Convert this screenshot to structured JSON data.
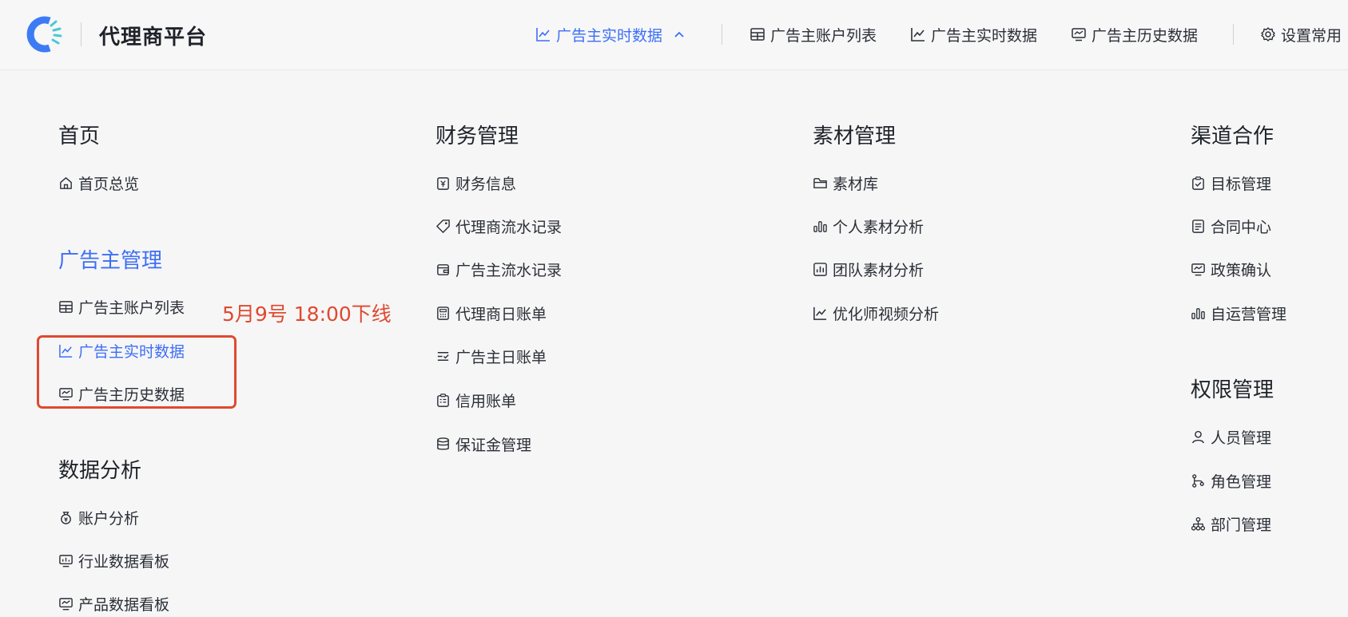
{
  "header": {
    "brand": "代理商平台",
    "active_nav": {
      "label": "广告主实时数据",
      "icon": "line-chart-icon"
    },
    "shortcuts": [
      {
        "label": "广告主账户列表",
        "icon": "table-icon"
      },
      {
        "label": "广告主实时数据",
        "icon": "line-chart-icon"
      },
      {
        "label": "广告主历史数据",
        "icon": "monitor-chart-icon"
      }
    ],
    "settings": {
      "label": "设置常用",
      "icon": "gear-icon"
    }
  },
  "columns": {
    "home": {
      "title": "首页",
      "items": [
        {
          "label": "首页总览",
          "icon": "home-icon"
        }
      ]
    },
    "advertiser": {
      "title": "广告主管理",
      "items": [
        {
          "label": "广告主账户列表",
          "icon": "table-icon"
        },
        {
          "label": "广告主实时数据",
          "icon": "line-chart-icon"
        },
        {
          "label": "广告主历史数据",
          "icon": "monitor-chart-icon"
        }
      ]
    },
    "analysis": {
      "title": "数据分析",
      "items": [
        {
          "label": "账户分析",
          "icon": "money-bag-icon"
        },
        {
          "label": "行业数据看板",
          "icon": "dashboard-icon"
        },
        {
          "label": "产品数据看板",
          "icon": "monitor-chart-icon"
        }
      ]
    },
    "finance": {
      "title": "财务管理",
      "items": [
        {
          "label": "财务信息",
          "icon": "finance-doc-icon"
        },
        {
          "label": "代理商流水记录",
          "icon": "tag-icon"
        },
        {
          "label": "广告主流水记录",
          "icon": "wallet-icon"
        },
        {
          "label": "代理商日账单",
          "icon": "calculator-icon"
        },
        {
          "label": "广告主日账单",
          "icon": "list-check-icon"
        },
        {
          "label": "信用账单",
          "icon": "clipboard-icon"
        },
        {
          "label": "保证金管理",
          "icon": "database-icon"
        }
      ]
    },
    "material": {
      "title": "素材管理",
      "items": [
        {
          "label": "素材库",
          "icon": "folder-icon"
        },
        {
          "label": "个人素材分析",
          "icon": "bar-chart-icon"
        },
        {
          "label": "团队素材分析",
          "icon": "board-chart-icon"
        },
        {
          "label": "优化师视频分析",
          "icon": "line-chart-icon"
        }
      ]
    },
    "channel": {
      "title": "渠道合作",
      "items": [
        {
          "label": "目标管理",
          "icon": "clipboard-check-icon"
        },
        {
          "label": "合同中心",
          "icon": "document-icon"
        },
        {
          "label": "政策确认",
          "icon": "monitor-chart-icon"
        },
        {
          "label": "自运营管理",
          "icon": "bar-chart-icon"
        }
      ]
    },
    "permission": {
      "title": "权限管理",
      "items": [
        {
          "label": "人员管理",
          "icon": "user-icon"
        },
        {
          "label": "角色管理",
          "icon": "branch-icon"
        },
        {
          "label": "部门管理",
          "icon": "org-chart-icon"
        }
      ]
    }
  },
  "annotation": {
    "text": "5月9号 18:00下线"
  },
  "colors": {
    "accent": "#3d6ff5",
    "annotation": "#e0492f",
    "text": "#2b2f36"
  }
}
